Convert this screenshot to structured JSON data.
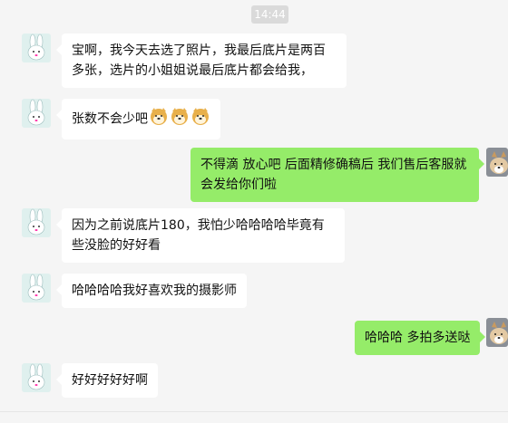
{
  "time_label": "14:44",
  "messages": [
    {
      "side": "in",
      "text": "宝啊，我今天去选了照片，我最后底片是两百多张，选片的小姐姐说最后底片都会给我，"
    },
    {
      "side": "in",
      "text": "张数不会少吧",
      "emoji": [
        "doge-icon",
        "doge-icon",
        "doge-icon"
      ]
    },
    {
      "side": "out",
      "text": "不得滴  放心吧 后面精修确稿后 我们售后客服就会发给你们啦"
    },
    {
      "side": "in",
      "text": "因为之前说底片180，我怕少哈哈哈哈毕竟有些没脸的好好看"
    },
    {
      "side": "in",
      "text": "哈哈哈哈我好喜欢我的摄影师"
    },
    {
      "side": "out",
      "text": "哈哈哈 多拍多送哒"
    },
    {
      "side": "in",
      "text": "好好好好好啊"
    }
  ],
  "colors": {
    "outgoing_bubble": "#95ec69",
    "incoming_bubble": "#ffffff",
    "background": "#f5f5f5"
  }
}
